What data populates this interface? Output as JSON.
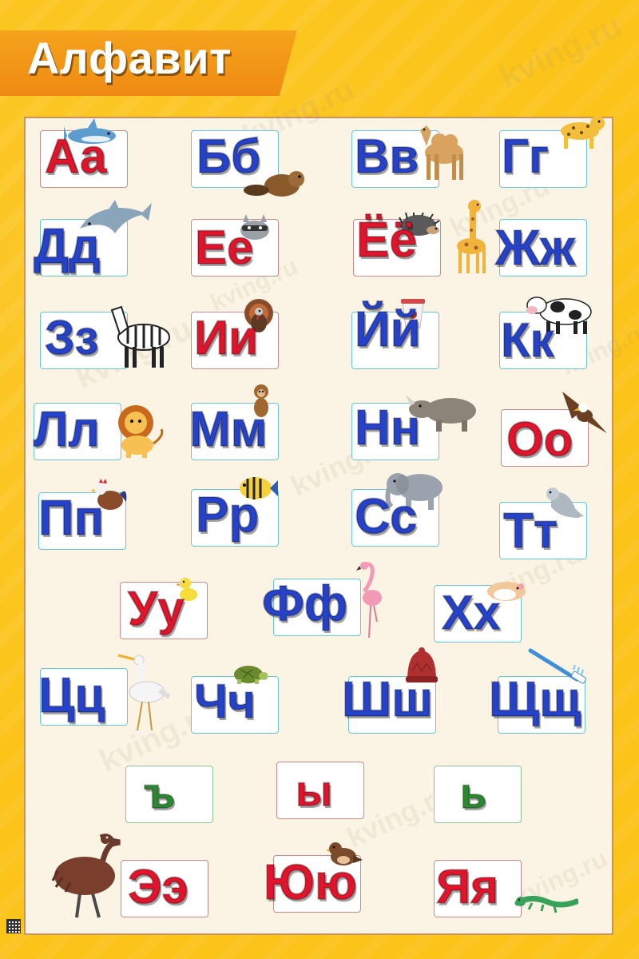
{
  "title": "Алфавит",
  "watermark_text": "kving.ru",
  "colors": {
    "blue": "#2542c8",
    "red": "#e0142b",
    "green": "#2b8a2f",
    "background": "#fcc418",
    "banner": "#f08f14"
  },
  "letters": [
    {
      "text": "Аа",
      "color": "red",
      "animal": "shark-icon"
    },
    {
      "text": "Бб",
      "color": "blue",
      "animal": "beaver-icon"
    },
    {
      "text": "Вв",
      "color": "blue",
      "animal": "camel-icon"
    },
    {
      "text": "Гг",
      "color": "blue",
      "animal": "cheetah-icon"
    },
    {
      "text": "Дд",
      "color": "blue",
      "animal": "dolphin-icon"
    },
    {
      "text": "Ее",
      "color": "red",
      "animal": "raccoon-icon"
    },
    {
      "text": "Ёё",
      "color": "red",
      "animal": "hedgehog-icon"
    },
    {
      "text": "Жж",
      "color": "blue",
      "animal": "giraffe-icon"
    },
    {
      "text": "Зз",
      "color": "blue",
      "animal": "zebra-icon"
    },
    {
      "text": "Ии",
      "color": "red",
      "animal": "turkey-icon"
    },
    {
      "text": "Йй",
      "color": "blue",
      "animal": "yogurt-icon"
    },
    {
      "text": "Кк",
      "color": "blue",
      "animal": "cow-icon"
    },
    {
      "text": "Лл",
      "color": "blue",
      "animal": "lion-icon"
    },
    {
      "text": "Мм",
      "color": "blue",
      "animal": "monkey-icon"
    },
    {
      "text": "Нн",
      "color": "blue",
      "animal": "rhinoceros-icon"
    },
    {
      "text": "Оо",
      "color": "red",
      "animal": "eagle-icon"
    },
    {
      "text": "Пп",
      "color": "blue",
      "animal": "rooster-icon"
    },
    {
      "text": "Рр",
      "color": "blue",
      "animal": "fish-icon"
    },
    {
      "text": "Сс",
      "color": "blue",
      "animal": "elephant-icon"
    },
    {
      "text": "Тт",
      "color": "blue",
      "animal": "seal-icon"
    },
    {
      "text": "Уу",
      "color": "red",
      "animal": "duckling-icon"
    },
    {
      "text": "Фф",
      "color": "blue",
      "animal": "flamingo-icon"
    },
    {
      "text": "Хх",
      "color": "blue",
      "animal": "hamster-icon"
    },
    {
      "text": "Цц",
      "color": "blue",
      "animal": "heron-icon"
    },
    {
      "text": "Чч",
      "color": "blue",
      "animal": "turtle-icon"
    },
    {
      "text": "Шш",
      "color": "blue",
      "animal": "hat-icon"
    },
    {
      "text": "Щщ",
      "color": "blue",
      "animal": "toothbrush-icon"
    },
    {
      "text": "ъ",
      "color": "green",
      "animal": ""
    },
    {
      "text": "ы",
      "color": "red",
      "animal": ""
    },
    {
      "text": "ь",
      "color": "green",
      "animal": ""
    },
    {
      "text": "Ээ",
      "color": "red",
      "animal": "emu-icon"
    },
    {
      "text": "Юю",
      "color": "red",
      "animal": "bird-icon"
    },
    {
      "text": "Яя",
      "color": "red",
      "animal": "lizard-icon"
    }
  ]
}
